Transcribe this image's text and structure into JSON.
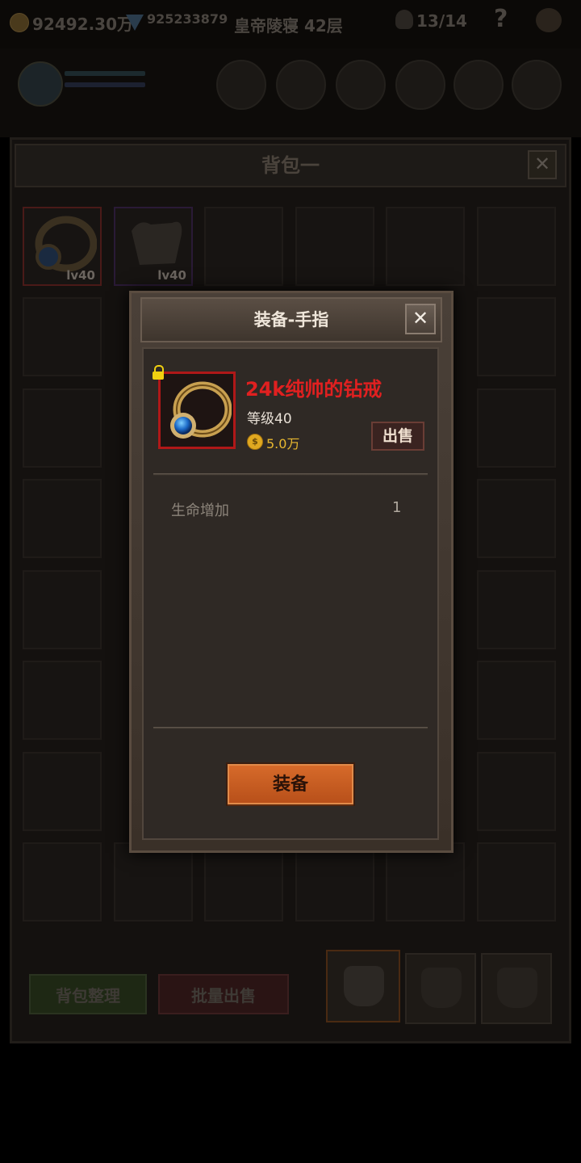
{
  "topbar": {
    "gold_value": "92492.30万",
    "gem_value": "925233879",
    "floor_label": "皇帝陵寝 42层",
    "skull_count": "13/14",
    "help_symbol": "?"
  },
  "bag": {
    "title": "背包一",
    "items": [
      {
        "level_label": "lv40",
        "kind": "ring",
        "border_color": "#8a1e1e"
      },
      {
        "level_label": "lv40",
        "kind": "armor",
        "border_color": "#5a2a7a"
      }
    ],
    "sort_button": "背包整理",
    "bulk_sell_button": "批量出售"
  },
  "modal": {
    "title": "装备-手指",
    "item_name": "24k纯帅的钻戒",
    "item_level": "等级40",
    "item_price": "5.0万",
    "sell_button": "出售",
    "stats": [
      {
        "label": "生命增加",
        "value": "1"
      }
    ],
    "equip_button": "装备",
    "locked": true
  },
  "colors": {
    "item_name": "#e02020",
    "equip_button": "#c85a20",
    "rare_border": "#b01818"
  }
}
